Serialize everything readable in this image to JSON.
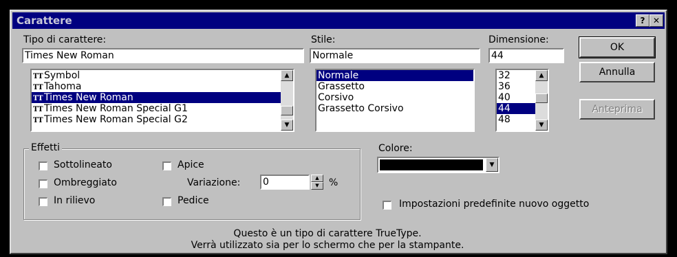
{
  "window": {
    "title": "Carattere",
    "help_btn": "?",
    "close_btn": "✕"
  },
  "font": {
    "label": "Tipo di carattere:",
    "value": "Times New Roman",
    "items": [
      {
        "icon": "truetype-icon",
        "label": "Symbol",
        "selected": false
      },
      {
        "icon": "truetype-icon",
        "label": "Tahoma",
        "selected": false
      },
      {
        "icon": "truetype-icon",
        "label": "Times New Roman",
        "selected": true
      },
      {
        "icon": "truetype-icon",
        "label": "Times New Roman Special G1",
        "selected": false
      },
      {
        "icon": "truetype-icon",
        "label": "Times New Roman Special G2",
        "selected": false
      }
    ]
  },
  "style": {
    "label": "Stile:",
    "value": "Normale",
    "items": [
      {
        "label": "Normale",
        "selected": true
      },
      {
        "label": "Grassetto",
        "selected": false
      },
      {
        "label": "Corsivo",
        "selected": false
      },
      {
        "label": "Grassetto Corsivo",
        "selected": false
      }
    ]
  },
  "size": {
    "label": "Dimensione:",
    "value": "44",
    "items": [
      {
        "label": "32",
        "selected": false
      },
      {
        "label": "36",
        "selected": false
      },
      {
        "label": "40",
        "selected": false
      },
      {
        "label": "44",
        "selected": true
      },
      {
        "label": "48",
        "selected": false
      }
    ]
  },
  "buttons": {
    "ok": "OK",
    "cancel": "Annulla",
    "preview": "Anteprima"
  },
  "effects": {
    "label": "Effetti",
    "underline": "Sottolineato",
    "shadow": "Ombreggiato",
    "emboss": "In rilievo",
    "superscript": "Apice",
    "offset_label": "Variazione:",
    "offset_value": "0",
    "offset_unit": "%",
    "subscript": "Pedice"
  },
  "color": {
    "label": "Colore:",
    "value": "#000000"
  },
  "default_checkbox": "Impostazioni predefinite nuovo oggetto",
  "info": {
    "line1": "Questo è un tipo di carattere TrueType.",
    "line2": "Verrà utilizzato sia per lo schermo che per la stampante."
  }
}
